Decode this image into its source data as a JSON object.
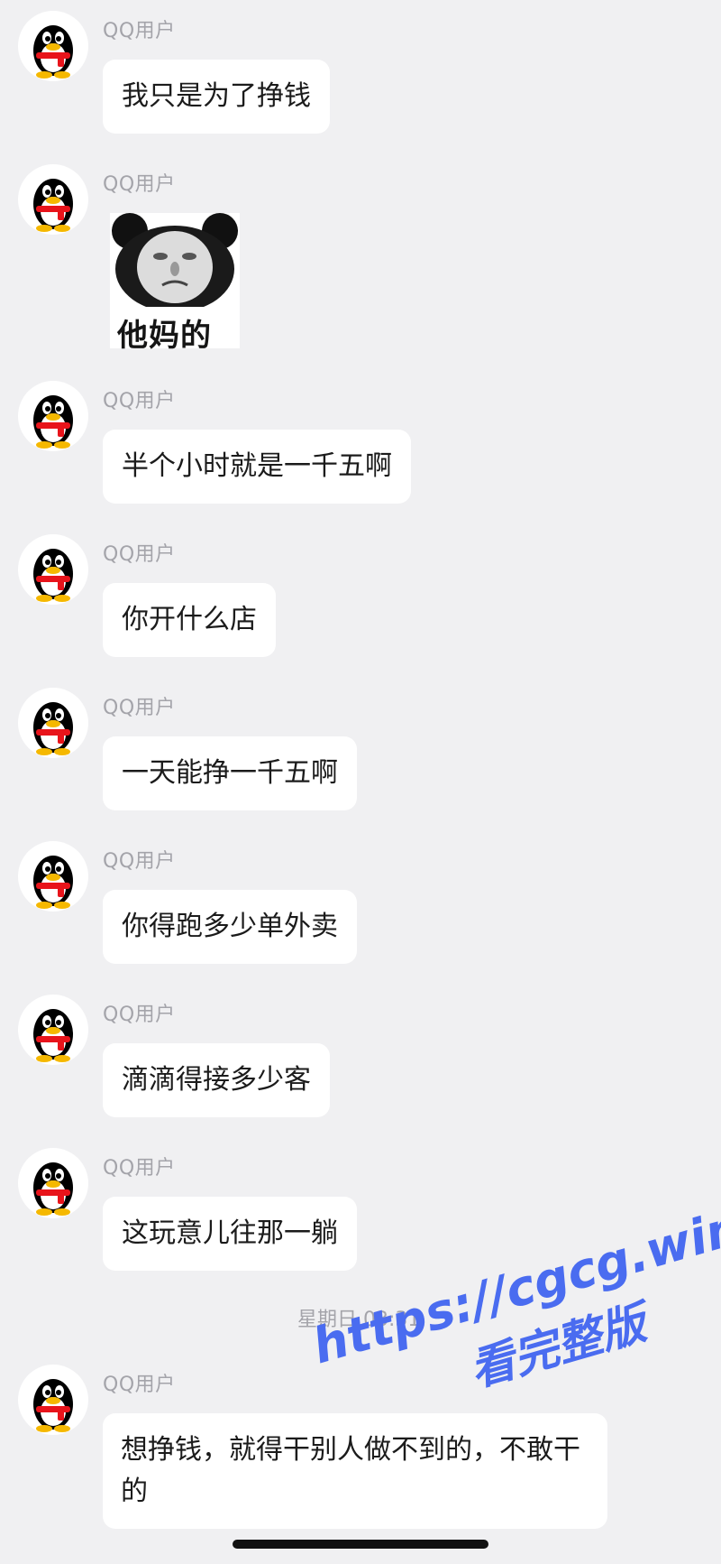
{
  "chat": {
    "sender_name": "QQ用户",
    "messages": [
      {
        "text": "我只是为了挣钱"
      },
      {
        "sticker_caption": "他妈的"
      },
      {
        "text": "半个小时就是一千五啊"
      },
      {
        "text": "你开什么店"
      },
      {
        "text": "一天能挣一千五啊"
      },
      {
        "text": "你得跑多少单外卖"
      },
      {
        "text": "滴滴得接多少客"
      },
      {
        "text": "这玩意儿往那一躺"
      },
      {
        "text": "想挣钱，就得干别人做不到的，不敢干的"
      }
    ],
    "timestamp": "星期日 03:31"
  },
  "watermark": {
    "url": "https://cgcg.win",
    "subtitle": "看完整版",
    "color": "#4a6cf0"
  },
  "icons": {
    "avatar": "qq-penguin-icon"
  }
}
